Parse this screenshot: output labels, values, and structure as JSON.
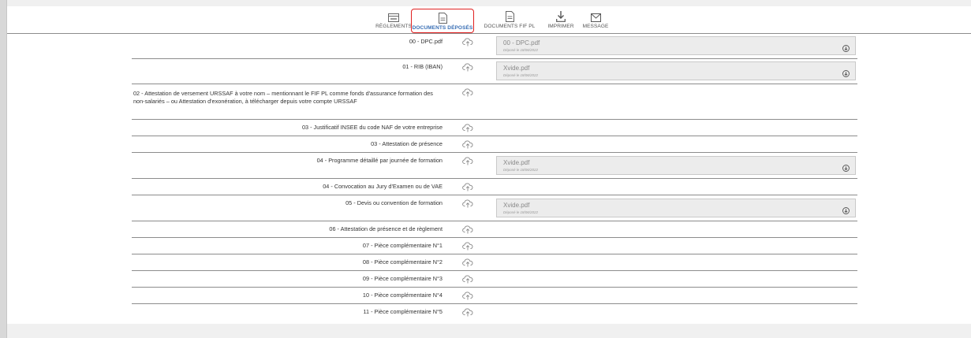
{
  "toolbar": {
    "reglements": "RÈGLEMENTS",
    "documents_deposes": "DOCUMENTS DÉPOSÉS",
    "documents_fif_pl": "DOCUMENTS FIF PL",
    "imprimer": "IMPRIMER",
    "message": "MESSAGE"
  },
  "colors": {
    "active_border": "#e02020",
    "active_label": "#3a6fb5"
  },
  "rows": [
    {
      "label": "00 - DPC.pdf",
      "file": "00 - DPC.pdf",
      "date": "Déposé le 18/06/2022"
    },
    {
      "label": "01 - RIB (IBAN)",
      "file": "Xvide.pdf",
      "date": "Déposé le 18/06/2022"
    },
    {
      "label": "02 - Attestation de versement URSSAF à votre nom – mentionnant le FIF PL comme fonds d'assurance formation des non-salariés – ou Attestation d'exonération, à télécharger depuis votre compte URSSAF"
    },
    {
      "label": "03 - Justificatif INSEE du code NAF de votre entreprise"
    },
    {
      "label": "03 - Attestation de présence"
    },
    {
      "label": "04 - Programme détaillé par journée de formation",
      "file": "Xvide.pdf",
      "date": "Déposé le 18/06/2022"
    },
    {
      "label": "04 - Convocation au Jury d'Examen ou de VAE"
    },
    {
      "label": "05 - Devis ou convention de formation",
      "file": "Xvide.pdf",
      "date": "Déposé le 18/06/2022"
    },
    {
      "label": "06 - Attestation de présence et de règlement"
    },
    {
      "label": "07 - Pièce complémentaire N°1"
    },
    {
      "label": "08 - Pièce complémentaire N°2"
    },
    {
      "label": "09 - Pièce complémentaire N°3"
    },
    {
      "label": "10 - Pièce complémentaire N°4"
    },
    {
      "label": "11 - Pièce complémentaire N°5"
    }
  ]
}
